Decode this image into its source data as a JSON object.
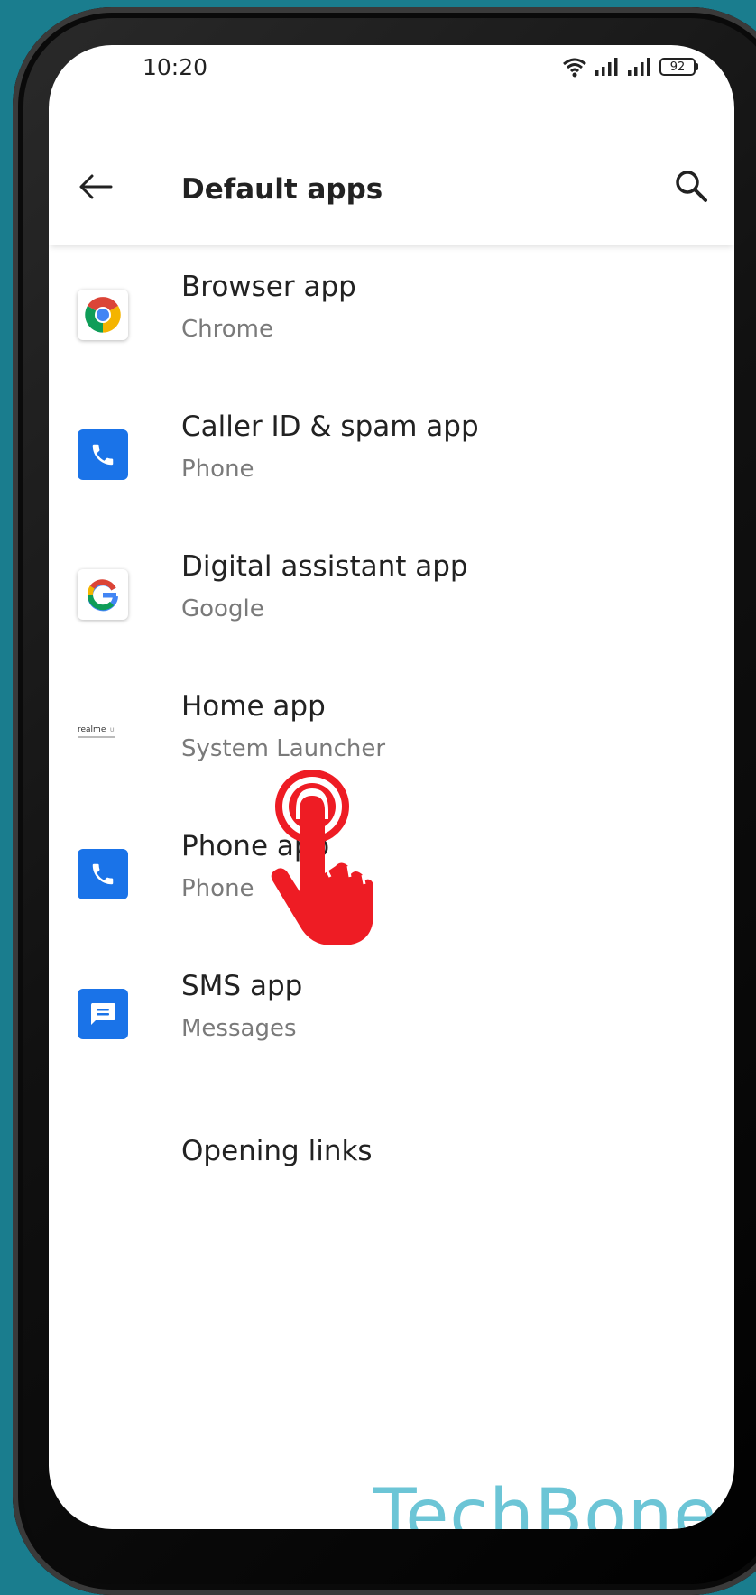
{
  "status_bar": {
    "time": "10:20",
    "battery_level": "92"
  },
  "app_bar": {
    "title": "Default apps",
    "back_icon": "arrow-left-icon",
    "search_icon": "search-icon"
  },
  "items": [
    {
      "title": "Browser app",
      "subtitle": "Chrome",
      "icon": "chrome-icon"
    },
    {
      "title": "Caller ID & spam app",
      "subtitle": "Phone",
      "icon": "phone-icon"
    },
    {
      "title": "Digital assistant app",
      "subtitle": "Google",
      "icon": "google-icon"
    },
    {
      "title": "Home app",
      "subtitle": "System Launcher",
      "icon": "realme-ui-logo-icon"
    },
    {
      "title": "Phone app",
      "subtitle": "Phone",
      "icon": "phone-icon"
    },
    {
      "title": "SMS app",
      "subtitle": "Messages",
      "icon": "messages-icon"
    },
    {
      "title": "Opening links"
    }
  ],
  "watermark": "TechBone",
  "colors": {
    "background": "#1a7d8e",
    "accent_blue": "#1a73e8",
    "touch_red": "#ee1c24",
    "watermark": "#6cc5d6"
  }
}
